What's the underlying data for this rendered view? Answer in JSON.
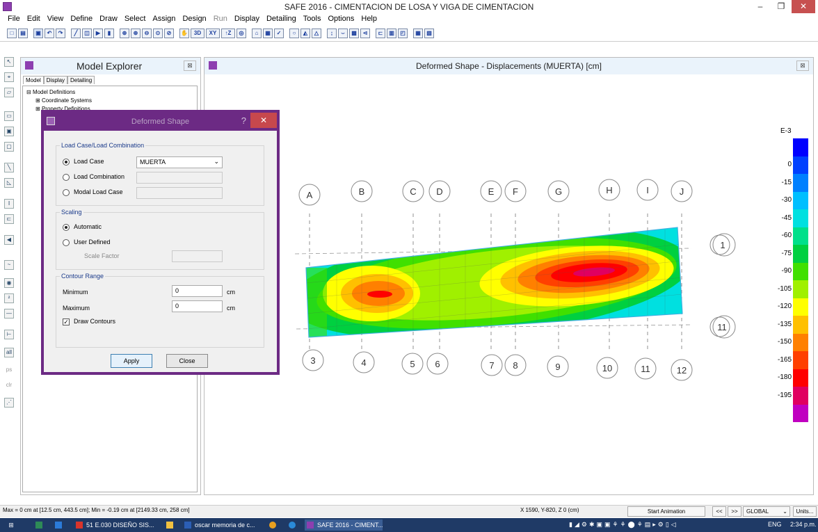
{
  "window": {
    "title": "SAFE 2016 - CIMENTACION DE LOSA Y VIGA DE CIMENTACION",
    "minimize": "–",
    "restore": "❐",
    "close": "✕"
  },
  "menu": {
    "items": [
      "File",
      "Edit",
      "View",
      "Define",
      "Draw",
      "Select",
      "Assign",
      "Design",
      "Run",
      "Display",
      "Detailing",
      "Tools",
      "Options",
      "Help"
    ],
    "disabled": [
      "Run"
    ]
  },
  "toolbar": {
    "buttons": [
      "new-icon",
      "open-icon",
      "save-icon",
      "undo-icon",
      "redo-icon",
      "pointer-icon",
      "refresh-icon",
      "run-icon",
      "lock-icon",
      "zoom-window-icon",
      "zoom-in-icon",
      "zoom-out-icon",
      "zoom-fit-icon",
      "zoom-previous-icon",
      "pan-icon"
    ],
    "labels": {
      "view3d": "3D",
      "viewxy": "XY",
      "viewz": "↑Z"
    }
  },
  "explorer": {
    "title": "Model Explorer",
    "tabs": [
      "Model",
      "Display",
      "Detailing"
    ],
    "tree": [
      {
        "label": "Model Definitions",
        "prefix": "⊟"
      },
      {
        "label": "Coordinate Systems",
        "prefix": "⊞"
      },
      {
        "label": "Property Definitions",
        "prefix": "⊞"
      }
    ]
  },
  "main": {
    "title": "Deformed Shape - Displacements (MUERTA)  [cm]"
  },
  "dialog": {
    "title": "Deformed Shape",
    "help": "?",
    "close": "✕",
    "load_group": "Load Case/Load Combination",
    "load_case_label": "Load Case",
    "load_case_value": "MUERTA",
    "load_combo_label": "Load Combination",
    "modal_label": "Modal Load Case",
    "scaling_group": "Scaling",
    "automatic_label": "Automatic",
    "user_defined_label": "User Defined",
    "scale_factor_label": "Scale Factor",
    "contour_group": "Contour Range",
    "minimum_label": "Minimum",
    "minimum_value": "0",
    "maximum_label": "Maximum",
    "maximum_value": "0",
    "unit_cm": "cm",
    "draw_contours_label": "Draw Contours",
    "draw_contours_checked": true,
    "apply_label": "Apply",
    "close_label": "Close"
  },
  "grid": {
    "letters": [
      "A",
      "B",
      "C",
      "D",
      "E",
      "F",
      "G",
      "H",
      "I",
      "J"
    ],
    "numbers": [
      "3",
      "4",
      "5",
      "6",
      "7",
      "8",
      "9",
      "10",
      "11",
      "12"
    ],
    "right_top": "1",
    "right_bottom": "11"
  },
  "legend": {
    "exponent": "E-3",
    "ticks": [
      "0",
      "-15",
      "-30",
      "-45",
      "-60",
      "-75",
      "-90",
      "-105",
      "-120",
      "-135",
      "-150",
      "-165",
      "-180",
      "-195"
    ],
    "colors": [
      "#0000ff",
      "#0040ff",
      "#0080ff",
      "#00bfff",
      "#00e0e0",
      "#00e08a",
      "#00d040",
      "#40e000",
      "#a0f000",
      "#ffff00",
      "#ffc000",
      "#ff8000",
      "#ff4000",
      "#ff0000",
      "#e00060",
      "#c000c0"
    ]
  },
  "status": {
    "left": "Max = 0 cm at [12.5 cm, 443.5 cm];  Min = -0.19 cm at [2149.33 cm, 258 cm]",
    "coords": "X 1590,  Y-820,  Z 0  (cm)",
    "start_animation": "Start Animation",
    "prev": "<<",
    "next": ">>",
    "coord_system": "GLOBAL",
    "units": "Units..."
  },
  "taskbar": {
    "items": [
      {
        "label": "51 E.030 DISEÑO SIS...",
        "color": "#d9342b"
      },
      {
        "label": "",
        "color": "#f0c040"
      },
      {
        "label": "oscar memoria de c...",
        "color": "#2b5eb5"
      },
      {
        "label": "",
        "color": "#e8a020"
      },
      {
        "label": "",
        "color": "#2a8ad9"
      },
      {
        "label": "SAFE 2016 - CIMENT...",
        "color": "#8d3fb0"
      }
    ],
    "lang": "ENG",
    "time": "2:34 p.m."
  }
}
